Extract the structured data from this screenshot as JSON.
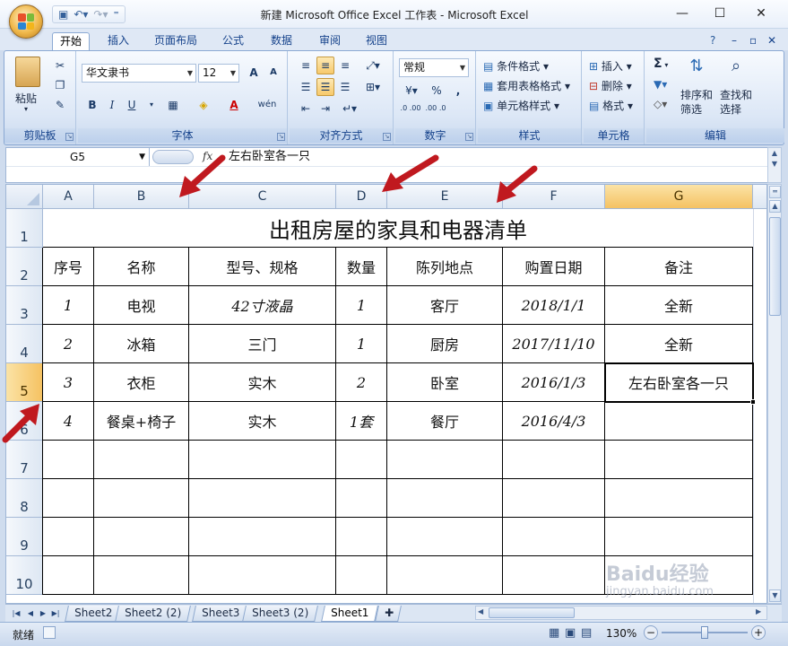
{
  "app": {
    "title": "新建 Microsoft Office Excel 工作表 - Microsoft Excel",
    "qat_more": "⁼",
    "win_controls": {
      "minimize": "—",
      "maximize": "☐",
      "close": "✕"
    },
    "doc_controls": {
      "help": "?",
      "minimize": "–",
      "restore": "▫",
      "close": "✕"
    }
  },
  "tabs": [
    "开始",
    "插入",
    "页面布局",
    "公式",
    "数据",
    "审阅",
    "视图"
  ],
  "active_tab": "开始",
  "ribbon": {
    "clipboard": {
      "label": "剪贴板",
      "paste": "粘贴"
    },
    "font": {
      "label": "字体",
      "font_name": "华文隶书",
      "font_size": "12",
      "grow": "A",
      "shrink": "A",
      "bold": "B",
      "italic": "I",
      "underline": "U",
      "phonetic": "wén"
    },
    "alignment": {
      "label": "对齐方式"
    },
    "number": {
      "label": "数字",
      "format": "常规",
      "percent": "%",
      "comma": ",",
      "inc_decimal": ".0 .00",
      "dec_decimal": ".00 .0"
    },
    "styles": {
      "label": "样式",
      "conditional": "条件格式",
      "table": "套用表格格式",
      "cell": "单元格样式"
    },
    "cells": {
      "label": "单元格",
      "insert": "插入",
      "delete": "删除",
      "format": "格式"
    },
    "editing": {
      "label": "编辑",
      "sigma": "Σ",
      "sort": [
        "排序和",
        "筛选"
      ],
      "find": [
        "查找和",
        "选择"
      ]
    }
  },
  "formula_bar": {
    "cell_ref": "G5",
    "fx": "fx",
    "value": "左右卧室各一只"
  },
  "columns": [
    "A",
    "B",
    "C",
    "D",
    "E",
    "F",
    "G"
  ],
  "selected_column": "G",
  "rows": [
    "1",
    "2",
    "3",
    "4",
    "5",
    "6",
    "7",
    "8",
    "9",
    "10"
  ],
  "selected_row": "5",
  "sheet_title": "出租房屋的家具和电器清单",
  "table": {
    "headers": [
      "序号",
      "名称",
      "型号、规格",
      "数量",
      "陈列地点",
      "购置日期",
      "备注"
    ],
    "rows": [
      [
        "1",
        "电视",
        "42寸液晶",
        "1",
        "客厅",
        "2018/1/1",
        "全新"
      ],
      [
        "2",
        "冰箱",
        "三门",
        "1",
        "厨房",
        "2017/11/10",
        "全新"
      ],
      [
        "3",
        "衣柜",
        "实木",
        "2",
        "卧室",
        "2016/1/3",
        "左右卧室各一只"
      ],
      [
        "4",
        "餐桌+椅子",
        "实木",
        "1套",
        "餐厅",
        "2016/4/3",
        ""
      ]
    ]
  },
  "sheet_tabs": [
    "Sheet2",
    "Sheet2 (2)",
    "Sheet3",
    "Sheet3 (2)",
    "Sheet1"
  ],
  "active_sheet": "Sheet1",
  "status": {
    "ready": "就绪",
    "zoom": "130%",
    "zoom_out": "−",
    "zoom_in": "+"
  },
  "watermark": {
    "brand": "Baidu经验",
    "url": "jingyan.baidu.com"
  },
  "colors": {
    "accent": "#15428b",
    "selected_header": "#f5c262",
    "annotation_arrow": "#c0191f"
  }
}
